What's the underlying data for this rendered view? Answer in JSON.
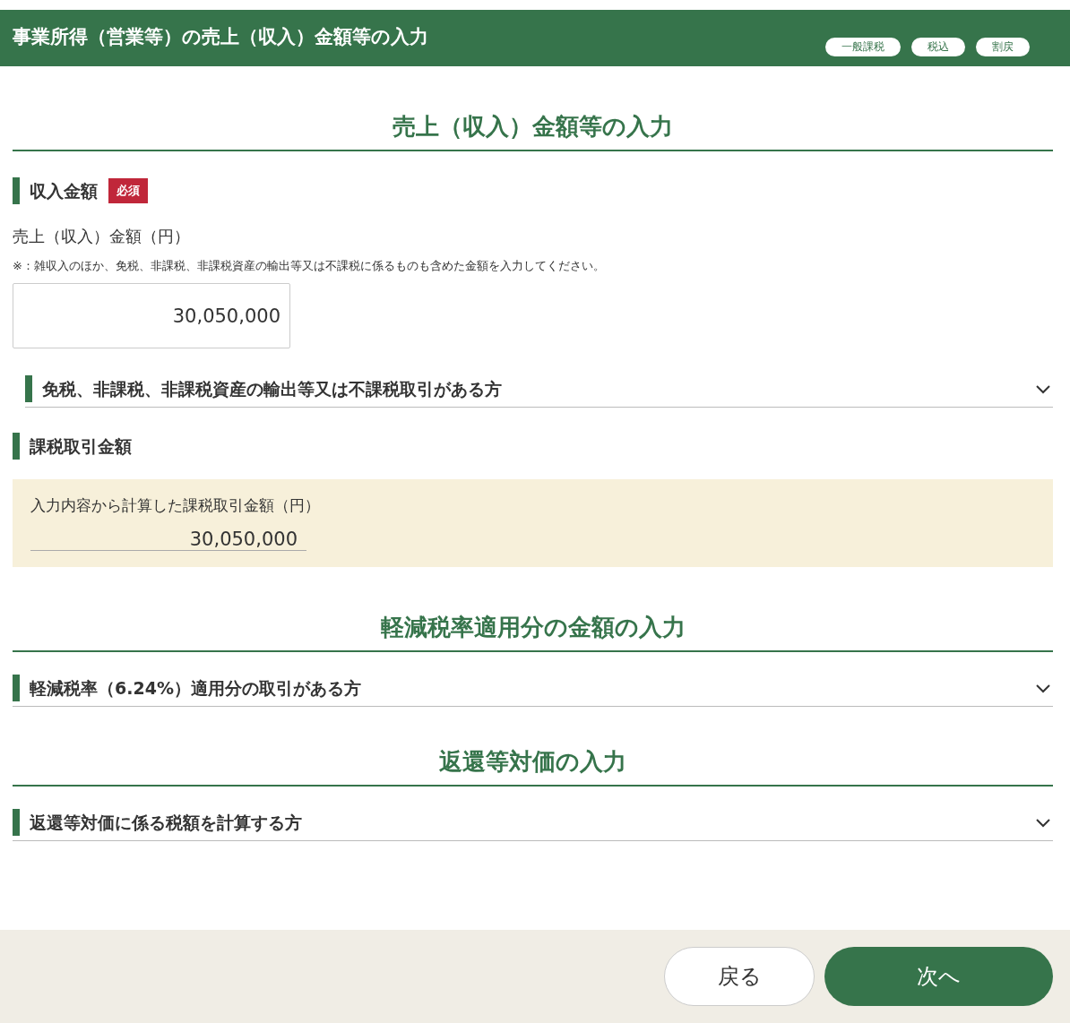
{
  "header": {
    "title": "事業所得（営業等）の売上（収入）金額等の入力",
    "badges": [
      "一般課税",
      "税込",
      "割戻"
    ]
  },
  "sections": [
    {
      "heading": "売上（収入）金額等の入力",
      "blocks": [
        {
          "kind": "input",
          "label": "収入金額",
          "required_badge": "必須",
          "field_label": "売上（収入）金額（円）",
          "note": "※：雑収入のほか、免税、非課税、非課税資産の輸出等又は不課税に係るものも含めた金額を入力してください。",
          "value": "30,050,000",
          "accordion": {
            "label": "免税、非課税、非課税資産の輸出等又は不課税取引がある方",
            "expanded": false
          }
        },
        {
          "kind": "computed",
          "label": "課税取引金額",
          "field_label": "入力内容から計算した課税取引金額（円）",
          "value": "30,050,000"
        }
      ]
    },
    {
      "heading": "軽減税率適用分の金額の入力",
      "blocks": [
        {
          "kind": "accordion",
          "label": "軽減税率（6.24%）適用分の取引がある方",
          "expanded": false
        }
      ]
    },
    {
      "heading": "返還等対価の入力",
      "blocks": [
        {
          "kind": "accordion",
          "label": "返還等対価に係る税額を計算する方",
          "expanded": false
        }
      ]
    }
  ],
  "buttons": [
    {
      "label": "戻る",
      "kind": "secondary"
    },
    {
      "label": "次へ",
      "kind": "primary"
    }
  ]
}
